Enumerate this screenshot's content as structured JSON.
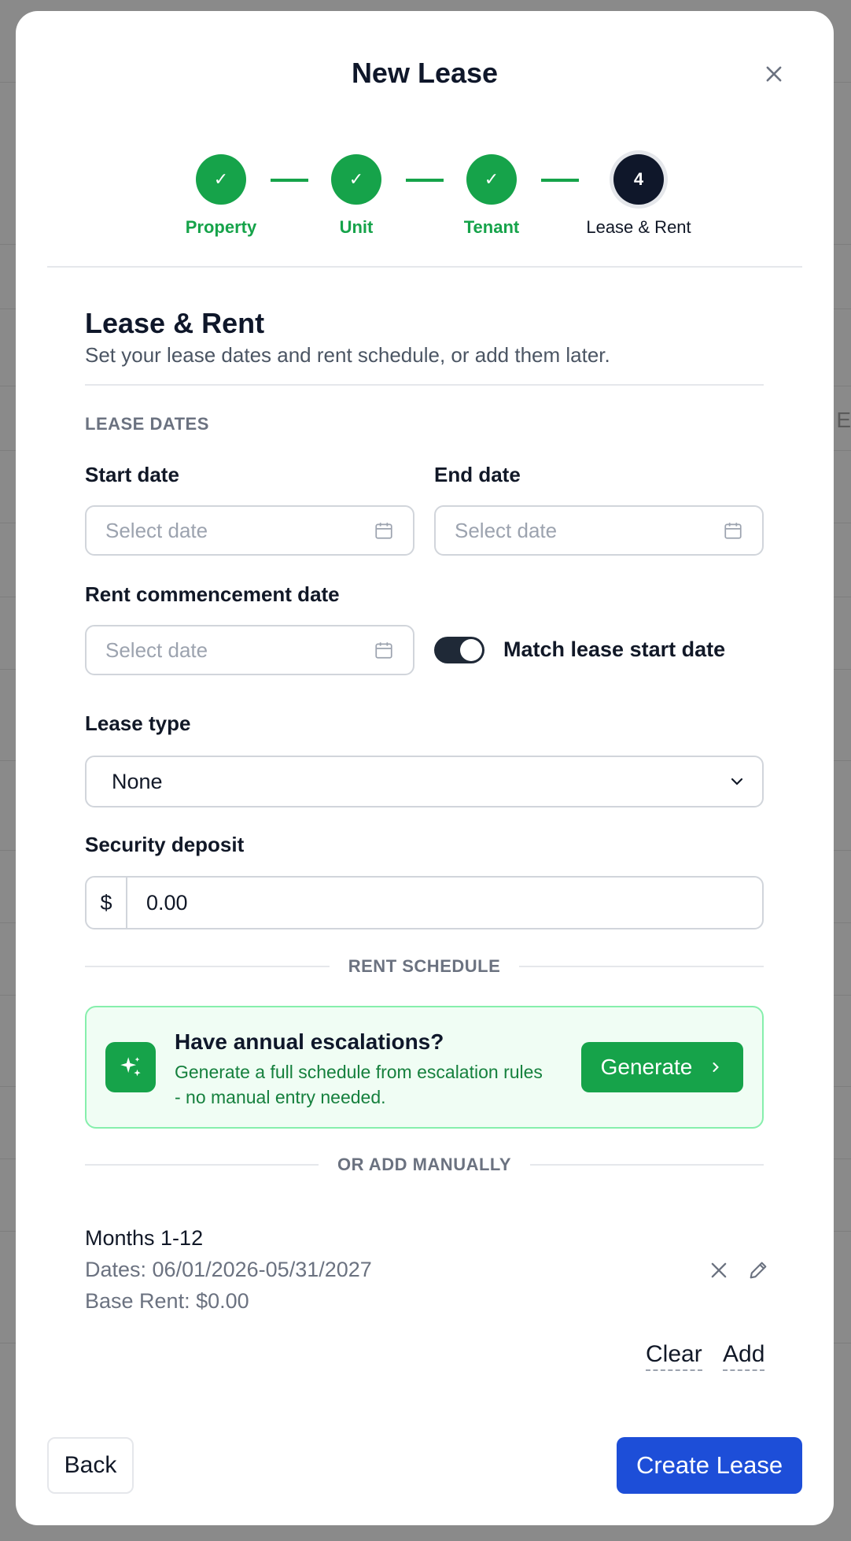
{
  "modal": {
    "title": "New Lease",
    "close_icon": "close-icon"
  },
  "stepper": {
    "steps": [
      {
        "label": "Property",
        "status": "complete",
        "marker": "✓"
      },
      {
        "label": "Unit",
        "status": "complete",
        "marker": "✓"
      },
      {
        "label": "Tenant",
        "status": "complete",
        "marker": "✓"
      },
      {
        "label": "Lease & Rent",
        "status": "active",
        "marker": "4"
      }
    ]
  },
  "section": {
    "title": "Lease & Rent",
    "subtitle": "Set your lease dates and rent schedule, or add them later."
  },
  "lease_dates": {
    "heading": "LEASE DATES",
    "start_label": "Start date",
    "start_placeholder": "Select date",
    "end_label": "End date",
    "end_placeholder": "Select date",
    "commencement_label": "Rent commencement date",
    "commencement_placeholder": "Select date",
    "match_toggle_label": "Match lease start date",
    "match_toggle_on": true
  },
  "lease_type": {
    "label": "Lease type",
    "selected": "None"
  },
  "deposit": {
    "label": "Security deposit",
    "prefix": "$",
    "value": "0.00"
  },
  "rent_schedule": {
    "heading": "RENT SCHEDULE",
    "escalation_title": "Have annual escalations?",
    "escalation_desc": "Generate a full schedule from escalation rules - no manual entry needed.",
    "generate_label": "Generate",
    "manual_heading": "OR ADD MANUALLY",
    "rows": [
      {
        "title": "Months 1-12",
        "dates": "Dates: 06/01/2026-05/31/2027",
        "rent": "Base Rent: $0.00"
      }
    ],
    "clear_label": "Clear",
    "add_label": "Add"
  },
  "footer": {
    "back_label": "Back",
    "create_label": "Create Lease"
  },
  "colors": {
    "success": "#16a34a",
    "primary": "#1d4ed8",
    "dark": "#0f172a",
    "overlay": "#8a8a8a"
  }
}
